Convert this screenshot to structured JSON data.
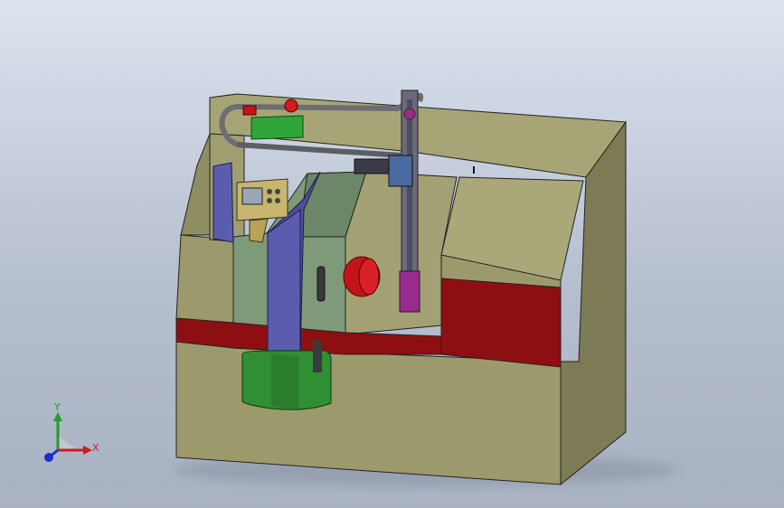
{
  "viewport": {
    "background_top": "#dde3ee",
    "background_bottom": "#a9b2c3"
  },
  "model_colors": {
    "body": "#9c9a6c",
    "body_dark": "#7d7b55",
    "body_light": "#b3b080",
    "red_band": "#8e0f12",
    "green_panel": "#7f9a79",
    "blue_column": "#4f4f9a",
    "green_base": "#2f8f32",
    "bright_green": "#2fa53a",
    "red_knob": "#c41419",
    "magenta": "#9b2a8f"
  },
  "triad": {
    "x_label": "X",
    "y_label": "Y",
    "x_color": "#c81e1e",
    "y_color": "#1e9e2a",
    "z_color": "#1e2ec8"
  }
}
